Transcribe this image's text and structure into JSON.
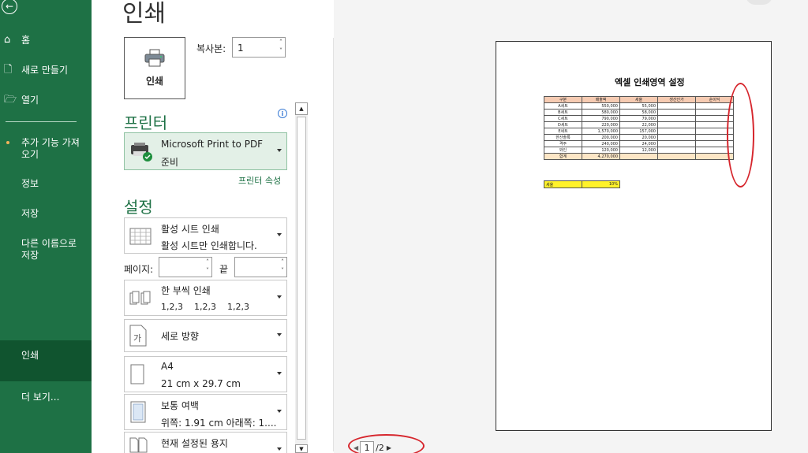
{
  "sidebar": {
    "items": [
      {
        "label": "홈",
        "icon": "home-icon"
      },
      {
        "label": "새로 만들기",
        "icon": "new-document-icon"
      },
      {
        "label": "열기",
        "icon": "folder-open-icon"
      },
      {
        "label": "추가 기능 가져오기"
      },
      {
        "label": "정보"
      },
      {
        "label": "저장"
      },
      {
        "label": "다른 이름으로 저장"
      },
      {
        "label": "인쇄"
      },
      {
        "label": "더 보기..."
      }
    ],
    "active": "인쇄"
  },
  "page_title": "인쇄",
  "print_button": {
    "label": "인쇄",
    "icon": "printer-icon"
  },
  "copies": {
    "label": "복사본:",
    "value": "1"
  },
  "printer": {
    "heading": "프린터",
    "name": "Microsoft Print to PDF",
    "status": "준비",
    "properties_link": "프린터 속성"
  },
  "settings": {
    "heading": "설정",
    "scope": {
      "title": "활성 시트 인쇄",
      "desc": "활성 시트만 인쇄합니다."
    },
    "pages": {
      "label": "페이지:",
      "to_label": "끝"
    },
    "collate": {
      "title": "한 부씩 인쇄",
      "desc": "1,2,3    1,2,3    1,2,3"
    },
    "orientation": {
      "title": "세로 방향"
    },
    "paper": {
      "title": "A4",
      "desc": "21 cm x 29.7 cm"
    },
    "margins": {
      "title": "보통 여백",
      "desc": "위쪽: 1.91 cm 아래쪽: 1...."
    },
    "scaling": {
      "title": "현재 설정된 용지"
    }
  },
  "preview": {
    "sheet_title": "엑셀 인쇄영역 설정",
    "headers": [
      "구분",
      "매출액",
      "세율",
      "생산인가",
      "순이익"
    ],
    "rows": [
      [
        "A세트",
        "550,000",
        "55,000"
      ],
      [
        "B세트",
        "580,000",
        "58,000"
      ],
      [
        "C세트",
        "790,000",
        "79,000"
      ],
      [
        "D세트",
        "220,000",
        "22,000"
      ],
      [
        "E세트",
        "1,570,000",
        "157,000"
      ],
      [
        "한산솔록",
        "200,000",
        "20,000"
      ],
      [
        "격주",
        "240,000",
        "24,000"
      ],
      [
        "와인",
        "120,000",
        "12,000"
      ]
    ],
    "total": {
      "label": "합계",
      "value": "4,270,000"
    },
    "tax": {
      "label": "세율",
      "value": "10%"
    }
  },
  "pager": {
    "current": "1",
    "total": "/2"
  }
}
